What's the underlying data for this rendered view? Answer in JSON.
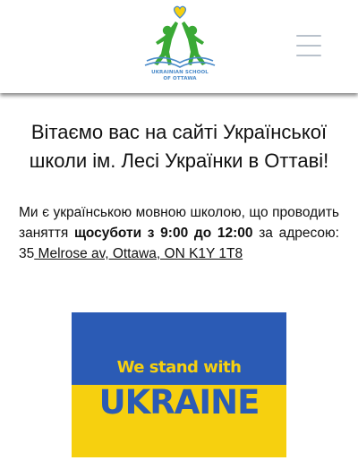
{
  "header": {
    "logo": {
      "line1": "UKRAINIAN SCHOOL",
      "line2": "OF OTTAWA",
      "colors": {
        "figures": "#3aa935",
        "heart": "#f6d00f",
        "book": "#4a8ac9"
      }
    },
    "menu_icon": "hamburger-menu-icon"
  },
  "main": {
    "welcome": "Вітаємо вас на сайті Української школи ім. Лесі Українки в Оттаві!",
    "intro": {
      "part1": "Ми є українською мовною школою, що проводить заняття ",
      "schedule": "щосуботи з 9:00 до 12:00",
      "part2": " за адресою: ",
      "address_num": "35",
      "address_rest": " Melrose av, Ottawa, ON K1Y 1T8"
    },
    "banner": {
      "line1": "We stand with",
      "line2": "UKRAINE",
      "colors": {
        "blue": "#2b5bb5",
        "yellow": "#f6d00f"
      }
    }
  }
}
